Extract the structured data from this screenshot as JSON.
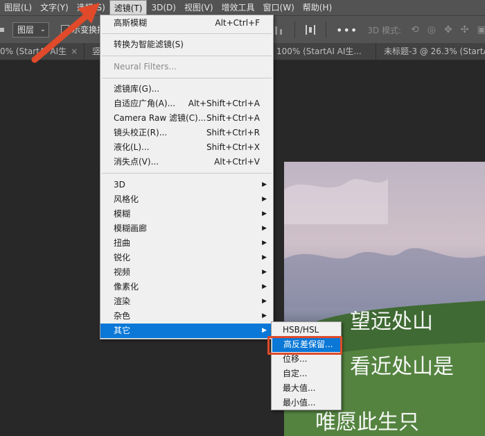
{
  "menubar": {
    "items": [
      "图层(L)",
      "文字(Y)",
      "选择(S)",
      "滤镜(T)",
      "3D(D)",
      "视图(V)",
      "增效工具",
      "窗口(W)",
      "帮助(H)"
    ],
    "active_index": 3
  },
  "options_bar": {
    "layer_select": "图层",
    "auto_select_label": "示变换控",
    "mode_label": "3D 模式:"
  },
  "tabs": [
    {
      "label": "0% (StartAI AI生"
    },
    {
      "label": "竖"
    },
    {
      "label": "100% (StartAI AI生..."
    },
    {
      "label": "未标题-3 @ 26.3% (StartAI AI生"
    }
  ],
  "filter_menu": {
    "items": [
      {
        "label": "高斯模糊",
        "shortcut": "Alt+Ctrl+F"
      },
      {
        "label": "转换为智能滤镜(S)",
        "shortcut": ""
      },
      {
        "label": "Neural Filters...",
        "shortcut": "",
        "disabled": true
      },
      {
        "label": "滤镜库(G)...",
        "shortcut": ""
      },
      {
        "label": "自适应广角(A)...",
        "shortcut": "Alt+Shift+Ctrl+A"
      },
      {
        "label": "Camera Raw 滤镜(C)...",
        "shortcut": "Shift+Ctrl+A"
      },
      {
        "label": "镜头校正(R)...",
        "shortcut": "Shift+Ctrl+R"
      },
      {
        "label": "液化(L)...",
        "shortcut": "Shift+Ctrl+X"
      },
      {
        "label": "消失点(V)...",
        "shortcut": "Alt+Ctrl+V"
      },
      {
        "label": "3D",
        "submenu": true
      },
      {
        "label": "风格化",
        "submenu": true
      },
      {
        "label": "模糊",
        "submenu": true
      },
      {
        "label": "模糊画廊",
        "submenu": true
      },
      {
        "label": "扭曲",
        "submenu": true
      },
      {
        "label": "锐化",
        "submenu": true
      },
      {
        "label": "视频",
        "submenu": true
      },
      {
        "label": "像素化",
        "submenu": true
      },
      {
        "label": "渲染",
        "submenu": true
      },
      {
        "label": "杂色",
        "submenu": true
      },
      {
        "label": "其它",
        "submenu": true,
        "highlighted": true
      }
    ]
  },
  "other_submenu": {
    "items": [
      {
        "label": "HSB/HSL"
      },
      {
        "label": "高反差保留...",
        "highlighted": true
      },
      {
        "label": "位移..."
      },
      {
        "label": "自定..."
      },
      {
        "label": "最大值..."
      },
      {
        "label": "最小值..."
      }
    ]
  },
  "canvas_text": [
    "望远处山",
    "看近处山是",
    "唯愿此生只"
  ],
  "colors": {
    "menu_highlight": "#0b78d7",
    "annotation_red": "#e04a2a"
  }
}
